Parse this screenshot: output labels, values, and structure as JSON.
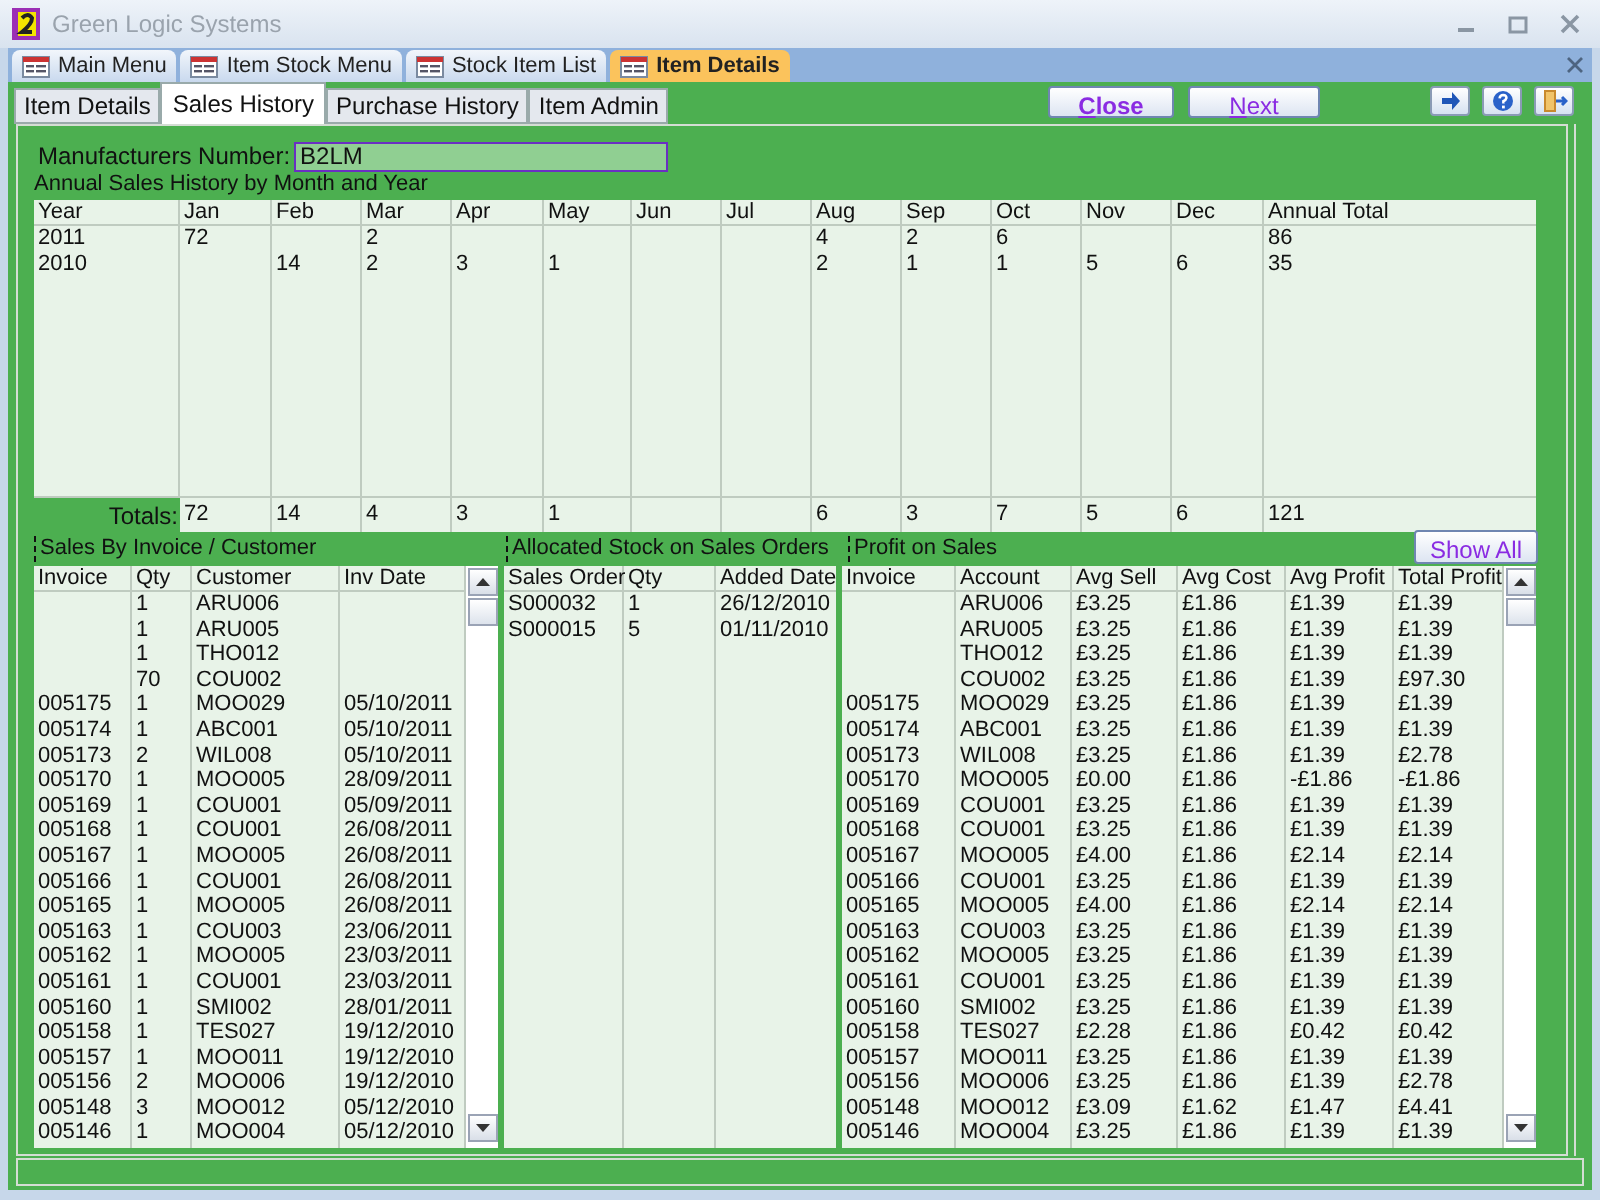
{
  "window": {
    "title": "Green Logic Systems"
  },
  "document_tabs": [
    {
      "label": "Main Menu",
      "selected": false
    },
    {
      "label": "Item Stock Menu",
      "selected": false
    },
    {
      "label": "Stock Item List",
      "selected": false
    },
    {
      "label": "Item Details",
      "selected": true
    }
  ],
  "form_tabs": [
    {
      "label": "Item Details",
      "selected": false
    },
    {
      "label": "Sales History",
      "selected": true
    },
    {
      "label": "Purchase History",
      "selected": false
    },
    {
      "label": "Item Admin",
      "selected": false
    }
  ],
  "buttons": [
    "Close",
    "Next"
  ],
  "manufacturers_number": {
    "label": "Manufacturers Number:",
    "value": "B2LM"
  },
  "annual_sales": {
    "title": "Annual Sales History by Month and Year",
    "columns": [
      "Year",
      "Jan",
      "Feb",
      "Mar",
      "Apr",
      "May",
      "Jun",
      "Jul",
      "Aug",
      "Sep",
      "Oct",
      "Nov",
      "Dec",
      "Annual Total"
    ],
    "rows": [
      [
        "2011",
        "72",
        null,
        "2",
        null,
        null,
        null,
        null,
        "4",
        "2",
        "6",
        null,
        null,
        "86"
      ],
      [
        "2010",
        null,
        "14",
        "2",
        "3",
        "1",
        null,
        null,
        "2",
        "1",
        "1",
        "5",
        "6",
        "35"
      ]
    ],
    "totals": {
      "label": "Totals:",
      "cells": [
        {
          "kind": "value",
          "value": "72"
        },
        {
          "kind": "value",
          "value": "14"
        },
        {
          "kind": "value",
          "value": "4"
        },
        {
          "kind": "value",
          "value": "3"
        },
        {
          "kind": "value",
          "value": "1"
        },
        {
          "kind": "blank"
        },
        {
          "kind": "blank"
        },
        {
          "kind": "value",
          "value": "6"
        },
        {
          "kind": "value",
          "value": "3"
        },
        {
          "kind": "value",
          "value": "7"
        },
        {
          "kind": "value",
          "value": "5"
        },
        {
          "kind": "value",
          "value": "6"
        },
        {
          "kind": "value",
          "value": "121"
        }
      ]
    }
  },
  "sales_by_invoice": {
    "title": "Sales By Invoice / Customer",
    "columns": [
      "Invoice",
      "Qty",
      "Customer",
      "Inv Date"
    ],
    "rows": [
      [
        null,
        "1",
        "ARU006",
        null
      ],
      [
        null,
        "1",
        "ARU005",
        null
      ],
      [
        null,
        "1",
        "THO012",
        null
      ],
      [
        null,
        "70",
        "COU002",
        null
      ],
      [
        "005175",
        "1",
        "MOO029",
        "05/10/2011"
      ],
      [
        "005174",
        "1",
        "ABC001",
        "05/10/2011"
      ],
      [
        "005173",
        "2",
        "WIL008",
        "05/10/2011"
      ],
      [
        "005170",
        "1",
        "MOO005",
        "28/09/2011"
      ],
      [
        "005169",
        "1",
        "COU001",
        "05/09/2011"
      ],
      [
        "005168",
        "1",
        "COU001",
        "26/08/2011"
      ],
      [
        "005167",
        "1",
        "MOO005",
        "26/08/2011"
      ],
      [
        "005166",
        "1",
        "COU001",
        "26/08/2011"
      ],
      [
        "005165",
        "1",
        "MOO005",
        "26/08/2011"
      ],
      [
        "005163",
        "1",
        "COU003",
        "23/06/2011"
      ],
      [
        "005162",
        "1",
        "MOO005",
        "23/03/2011"
      ],
      [
        "005161",
        "1",
        "COU001",
        "23/03/2011"
      ],
      [
        "005160",
        "1",
        "SMI002",
        "28/01/2011"
      ],
      [
        "005158",
        "1",
        "TES027",
        "19/12/2010"
      ],
      [
        "005157",
        "1",
        "MOO011",
        "19/12/2010"
      ],
      [
        "005156",
        "2",
        "MOO006",
        "19/12/2010"
      ],
      [
        "005148",
        "3",
        "MOO012",
        "05/12/2010"
      ],
      [
        "005146",
        "1",
        "MOO004",
        "05/12/2010"
      ]
    ]
  },
  "allocated_stock": {
    "title": "Allocated Stock on Sales Orders",
    "columns": [
      "Sales Order",
      "Qty",
      "Added Date"
    ],
    "rows": [
      [
        "S000032",
        "1",
        "26/12/2010"
      ],
      [
        "S000015",
        "5",
        "01/11/2010"
      ]
    ]
  },
  "profit_on_sales": {
    "title": "Profit on Sales",
    "show_all_button": "Show All",
    "columns": [
      "Invoice",
      "Account",
      "Avg Sell",
      "Avg Cost",
      "Avg Profit",
      "Total Profit"
    ],
    "rows": [
      [
        null,
        "ARU006",
        "£3.25",
        "£1.86",
        "£1.39",
        "£1.39"
      ],
      [
        null,
        "ARU005",
        "£3.25",
        "£1.86",
        "£1.39",
        "£1.39"
      ],
      [
        null,
        "THO012",
        "£3.25",
        "£1.86",
        "£1.39",
        "£1.39"
      ],
      [
        null,
        "COU002",
        "£3.25",
        "£1.86",
        "£1.39",
        "£97.30"
      ],
      [
        "005175",
        "MOO029",
        "£3.25",
        "£1.86",
        "£1.39",
        "£1.39"
      ],
      [
        "005174",
        "ABC001",
        "£3.25",
        "£1.86",
        "£1.39",
        "£1.39"
      ],
      [
        "005173",
        "WIL008",
        "£3.25",
        "£1.86",
        "£1.39",
        "£2.78"
      ],
      [
        "005170",
        "MOO005",
        "£0.00",
        "£1.86",
        "-£1.86",
        "-£1.86"
      ],
      [
        "005169",
        "COU001",
        "£3.25",
        "£1.86",
        "£1.39",
        "£1.39"
      ],
      [
        "005168",
        "COU001",
        "£3.25",
        "£1.86",
        "£1.39",
        "£1.39"
      ],
      [
        "005167",
        "MOO005",
        "£4.00",
        "£1.86",
        "£2.14",
        "£2.14"
      ],
      [
        "005166",
        "COU001",
        "£3.25",
        "£1.86",
        "£1.39",
        "£1.39"
      ],
      [
        "005165",
        "MOO005",
        "£4.00",
        "£1.86",
        "£2.14",
        "£2.14"
      ],
      [
        "005163",
        "COU003",
        "£3.25",
        "£1.86",
        "£1.39",
        "£1.39"
      ],
      [
        "005162",
        "MOO005",
        "£3.25",
        "£1.86",
        "£1.39",
        "£1.39"
      ],
      [
        "005161",
        "COU001",
        "£3.25",
        "£1.86",
        "£1.39",
        "£1.39"
      ],
      [
        "005160",
        "SMI002",
        "£3.25",
        "£1.86",
        "£1.39",
        "£1.39"
      ],
      [
        "005158",
        "TES027",
        "£2.28",
        "£1.86",
        "£0.42",
        "£0.42"
      ],
      [
        "005157",
        "MOO011",
        "£3.25",
        "£1.86",
        "£1.39",
        "£1.39"
      ],
      [
        "005156",
        "MOO006",
        "£3.25",
        "£1.86",
        "£1.39",
        "£2.78"
      ],
      [
        "005148",
        "MOO012",
        "£3.09",
        "£1.62",
        "£1.47",
        "£4.41"
      ],
      [
        "005146",
        "MOO004",
        "£3.25",
        "£1.86",
        "£1.39",
        "£1.39"
      ]
    ]
  }
}
